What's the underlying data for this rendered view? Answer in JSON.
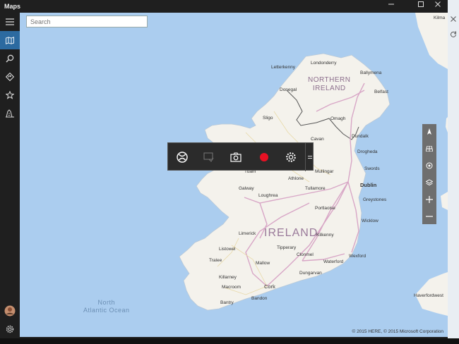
{
  "window": {
    "title": "Maps"
  },
  "search": {
    "placeholder": "Search"
  },
  "sidebar": {
    "items": [
      {
        "name": "menu",
        "icon": "hamburger-icon"
      },
      {
        "name": "map",
        "icon": "map-icon"
      },
      {
        "name": "search",
        "icon": "search-icon"
      },
      {
        "name": "directions",
        "icon": "directions-icon"
      },
      {
        "name": "favorites",
        "icon": "star-icon"
      },
      {
        "name": "3d-cities",
        "icon": "city-icon"
      }
    ],
    "bottom": [
      {
        "name": "account",
        "icon": "avatar-icon"
      },
      {
        "name": "settings",
        "icon": "gear-icon"
      }
    ]
  },
  "map": {
    "country": "IRELAND",
    "region": "NORTHERN\nIRELAND",
    "ocean": "North\nAtlantic Ocean",
    "copyright": "© 2015 HERE, © 2015 Microsoft Corporation",
    "cities": {
      "londonderry": "Londonderry",
      "letterkenny": "Letterkenny",
      "ballymena": "Ballymena",
      "donegal": "Donegal",
      "belfast": "Belfast",
      "omagh": "Omagh",
      "sligo": "Sligo",
      "cavan": "Cavan",
      "dundalk": "Dundalk",
      "drogheda": "Drogheda",
      "mullingar": "Mullingar",
      "swords": "Swords",
      "galway": "Galway",
      "athlone": "Athlone",
      "tuam": "Tuam",
      "tullamore": "Tullamore",
      "dublin": "Dublin",
      "loughrea": "Loughrea",
      "greystones": "Greystones",
      "portlaoise": "Portlaoise",
      "limerick": "Limerick",
      "kilkenny": "Kilkenny",
      "wicklow": "Wicklow",
      "listowel": "Listowel",
      "tipperary": "Tipperary",
      "clonmel": "Clonmel",
      "wexford": "Wexford",
      "tralee": "Tralee",
      "mallow": "Mallow",
      "dungarvan": "Dungarvan",
      "waterford": "Waterford",
      "killarney": "Killarney",
      "macroom": "Macroom",
      "cork": "Cork",
      "bantry": "Bantry",
      "bandon": "Bandon",
      "haverfordwest": "Haverfordwest",
      "kilmarnock": "Kilma"
    }
  },
  "gamebar": {
    "buttons": [
      "xbox-icon",
      "screenshot-disabled-icon",
      "camera-icon",
      "record-icon",
      "gear-icon"
    ]
  },
  "colors": {
    "water": "#abcdef",
    "land": "#f4f2ec",
    "road": "#d8a6c6",
    "record": "#e81123",
    "accent": "#2c6aa0"
  }
}
